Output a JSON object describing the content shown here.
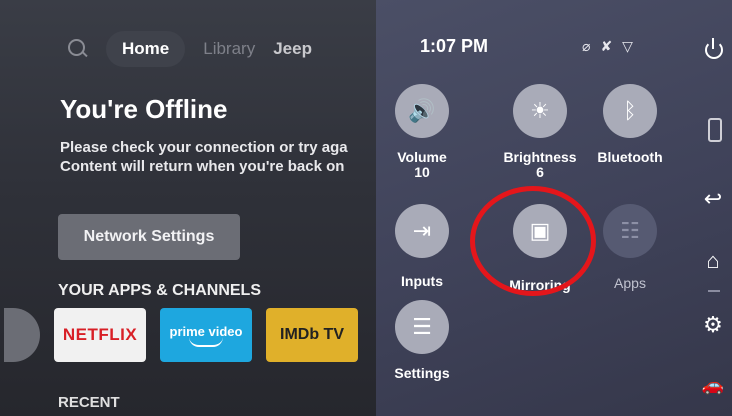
{
  "nav": {
    "home": "Home",
    "library": "Library",
    "profile": "Jeep"
  },
  "offline": {
    "title": "You're Offline",
    "line1": "Please check your connection or try aga",
    "line2": "Content will return when you're back on"
  },
  "network_button": "Network Settings",
  "apps_heading": "YOUR APPS & CHANNELS",
  "apps": {
    "netflix": "NETFLIX",
    "prime": "prime video",
    "imdb": "IMDb TV"
  },
  "recent_heading": "RECENT",
  "panel": {
    "time": "1:07 PM",
    "status_icons": [
      "no-wifi-icon",
      "mic-off-icon",
      "wifi-icon"
    ],
    "tiles": {
      "volume": {
        "label": "Volume",
        "value": "10",
        "icon": "speaker-icon"
      },
      "brightness": {
        "label": "Brightness",
        "value": "6",
        "icon": "sun-icon"
      },
      "bluetooth": {
        "label": "Bluetooth",
        "icon": "bluetooth-icon"
      },
      "inputs": {
        "label": "Inputs",
        "icon": "input-icon"
      },
      "mirroring": {
        "label": "Mirroring",
        "icon": "screen-mirror-icon"
      },
      "apps": {
        "label": "Apps",
        "icon": "apps-grid-icon"
      },
      "settings": {
        "label": "Settings",
        "icon": "sliders-icon"
      }
    },
    "side_icons": [
      "power-icon",
      "remote-icon",
      "back-icon",
      "home-icon",
      "gear-icon",
      "car-icon"
    ]
  },
  "colors": {
    "highlight": "#e4161b",
    "panel": "#454860",
    "netflix_red": "#d81f26",
    "prime_blue": "#1ea7df",
    "imdb_yellow": "#e0b02a"
  }
}
